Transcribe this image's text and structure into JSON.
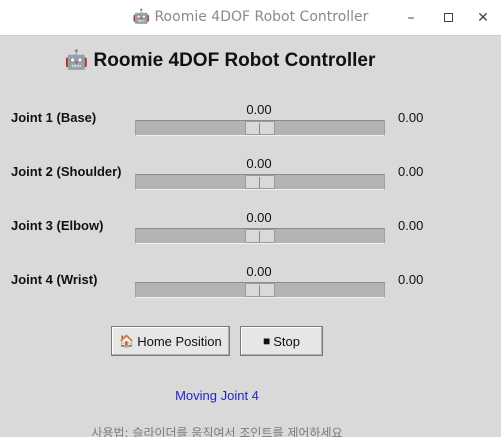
{
  "window": {
    "title": "🤖 Roomie 4DOF Robot Controller",
    "controls": {
      "minimize": "–",
      "close": "✕"
    }
  },
  "header": {
    "title": "🤖 Roomie 4DOF Robot Controller"
  },
  "joints": [
    {
      "label": "Joint 1 (Base)",
      "slider_value": "0.00",
      "readout": "0.00",
      "position": 0.5
    },
    {
      "label": "Joint 2 (Shoulder)",
      "slider_value": "0.00",
      "readout": "0.00",
      "position": 0.5
    },
    {
      "label": "Joint 3 (Elbow)",
      "slider_value": "0.00",
      "readout": "0.00",
      "position": 0.5
    },
    {
      "label": "Joint 4 (Wrist)",
      "slider_value": "0.00",
      "readout": "0.00",
      "position": 0.5
    }
  ],
  "buttons": {
    "home": {
      "icon": "house-icon",
      "icon_glyph": "🏠",
      "label": "Home Position"
    },
    "stop": {
      "icon": "stop-square-icon",
      "icon_glyph": "■",
      "label": "Stop"
    }
  },
  "status": {
    "text": "Moving Joint 4",
    "color": "#1f1fe0"
  },
  "usage": {
    "text": "사용법: 슬라이더를 움직여서 조인트를 제어하세요"
  }
}
